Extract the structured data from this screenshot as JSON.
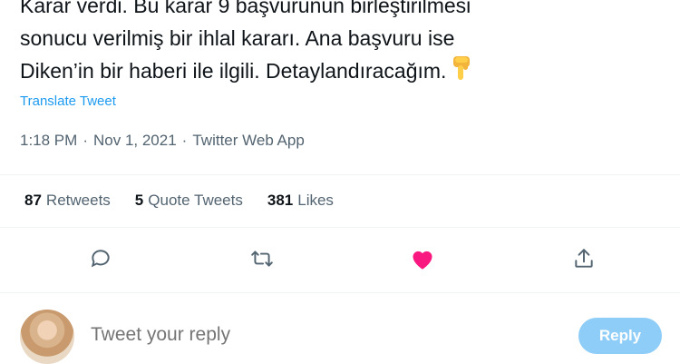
{
  "tweet": {
    "lines": [
      "Karar verdi. Bu karar 9 başvurunun birleştirilmesi",
      "sonucu verilmiş bir ihlal kararı. Ana başvuru ise",
      "Diken’in bir haberi ile ilgili. Detaylandıracağım."
    ],
    "emoji_icon": "pointing-down-hand-icon",
    "translate_label": "Translate Tweet",
    "time": "1:18 PM",
    "separator": "·",
    "date": "Nov 1, 2021",
    "source": "Twitter Web App"
  },
  "stats": {
    "retweets_count": "87",
    "retweets_label": "Retweets",
    "quotes_count": "5",
    "quotes_label": "Quote Tweets",
    "likes_count": "381",
    "likes_label": "Likes"
  },
  "actions": [
    {
      "icon": "reply-icon"
    },
    {
      "icon": "retweet-icon"
    },
    {
      "icon": "like-heart-icon",
      "active": true
    },
    {
      "icon": "share-icon"
    }
  ],
  "reply_box": {
    "placeholder": "Tweet your reply",
    "button_label": "Reply"
  },
  "colors": {
    "accent": "#1d9bf0",
    "like": "#f91880",
    "text_secondary": "#536471",
    "reply_button": "#8ecdf8"
  }
}
